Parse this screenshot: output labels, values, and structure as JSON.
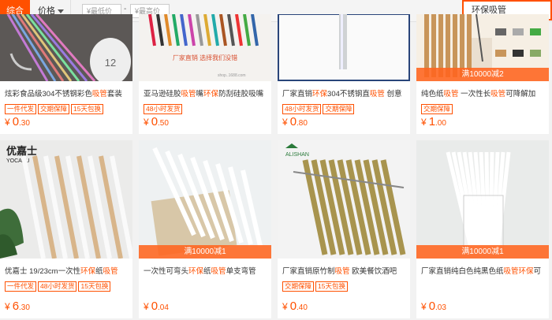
{
  "filters": {
    "sort_default": "综合",
    "sort_price": "价格",
    "min_price_placeholder": "¥最低价",
    "dash": "-",
    "max_price_placeholder": "¥最高价",
    "search_query": "环保吸管"
  },
  "products": [
    {
      "title": "炫彩食品级304不锈钢彩色吸管套装",
      "highlights": [
        "吸管"
      ],
      "tags": [
        "一件代发",
        "交期保障",
        "15天包换"
      ],
      "price_int": "0",
      "price_dec": ".30",
      "promo": ""
    },
    {
      "title": "亚马逊硅胶吸管嘴环保防刮硅胶吸嘴",
      "highlights": [
        "吸管",
        "环保"
      ],
      "tags": [
        "48小时发货"
      ],
      "price_int": "0",
      "price_dec": ".50",
      "promo": ""
    },
    {
      "title": "厂家直销环保304不锈钢直吸管 创意",
      "highlights": [
        "环保",
        "吸管"
      ],
      "tags": [
        "48小时发货",
        "交期保障"
      ],
      "price_int": "0",
      "price_dec": ".80",
      "promo": ""
    },
    {
      "title": "纯色纸吸管 一次性长吸管可降解加",
      "highlights": [
        "吸管",
        "吸管"
      ],
      "tags": [
        "交期保障"
      ],
      "price_int": "1",
      "price_dec": ".00",
      "promo": "满10000减2"
    },
    {
      "title": "优嘉士 19/23cm一次性环保纸吸管",
      "highlights": [
        "环保",
        "吸管"
      ],
      "tags": [
        "一件代发",
        "48小时发货",
        "15天包换"
      ],
      "price_int": "6",
      "price_dec": ".30",
      "promo": ""
    },
    {
      "title": "一次性可弯头环保纸吸管单支弯管",
      "highlights": [
        "环保",
        "吸管"
      ],
      "tags": [],
      "price_int": "0",
      "price_dec": ".04",
      "promo": "满10000减1"
    },
    {
      "title": "厂家直销原竹制吸管 欧美餐饮酒吧",
      "highlights": [
        "吸管"
      ],
      "tags": [
        "交期保障",
        "15天包换"
      ],
      "price_int": "0",
      "price_dec": ".40",
      "promo": ""
    },
    {
      "title": "厂家直销纯白色纯黑色纸吸管环保可",
      "highlights": [
        "吸管",
        "环保"
      ],
      "tags": [],
      "price_int": "0",
      "price_dec": ".03",
      "promo": "满10000减1"
    }
  ],
  "images": [
    {
      "text": "12"
    },
    {
      "text": ""
    },
    {
      "text": ""
    },
    {
      "text": ""
    },
    {
      "text": "优嘉士 YOCASU"
    },
    {
      "text": ""
    },
    {
      "text": "ALISHAN"
    },
    {
      "text": ""
    }
  ],
  "colors": {
    "accent": "#ff5000"
  }
}
